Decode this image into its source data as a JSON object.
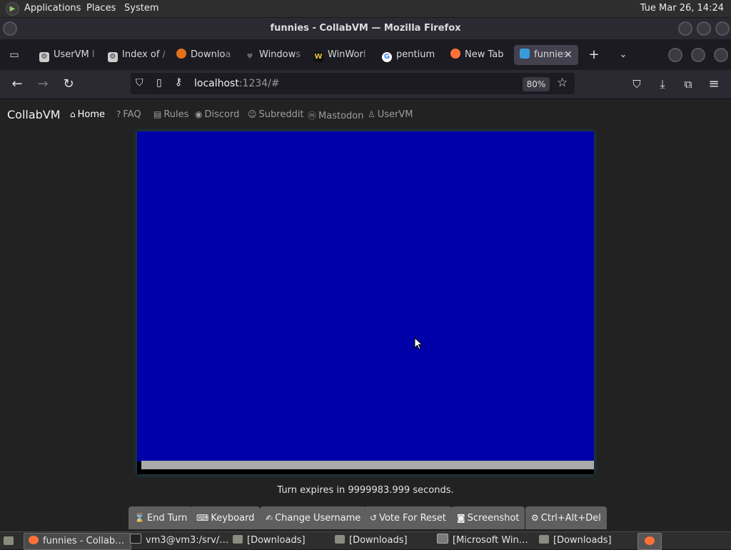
{
  "top_panel": {
    "menus": [
      "Applications",
      "Places",
      "System"
    ],
    "clock": "Tue Mar 26, 14:24"
  },
  "window": {
    "title": "funnies - CollabVM — Mozilla Firefox"
  },
  "tabs": [
    {
      "label": "UserVM",
      "fade": " l"
    },
    {
      "label": "Index of",
      "fade": " /"
    },
    {
      "label": "Downlo",
      "fade": "a"
    },
    {
      "label": "Window",
      "fade": "s"
    },
    {
      "label": "WinWor",
      "fade": "l"
    },
    {
      "label": "pentium",
      "fade": ""
    },
    {
      "label": "New Tab",
      "fade": ""
    },
    {
      "label": "funnie",
      "fade": "s"
    }
  ],
  "url": {
    "host": "localhost",
    "rest": ":1234/#",
    "zoom": "80%"
  },
  "site": {
    "brand": "CollabVM",
    "nav": [
      "Home",
      "FAQ",
      "Rules",
      "Discord",
      "Subreddit",
      "Mastodon",
      "UserVM"
    ]
  },
  "vm": {
    "turn_text": "Turn expires in 9999983.999 seconds.",
    "buttons": [
      "End Turn",
      "Keyboard",
      "Change Username",
      "Vote For Reset",
      "Screenshot",
      "Ctrl+Alt+Del"
    ],
    "screen_color": "#0000a8"
  },
  "taskbar": {
    "tasks": [
      "funnies - Collab…",
      "vm3@vm3:/srv/…",
      "[Downloads]",
      "[Downloads]",
      "[Microsoft Win…",
      "[Downloads]"
    ]
  }
}
